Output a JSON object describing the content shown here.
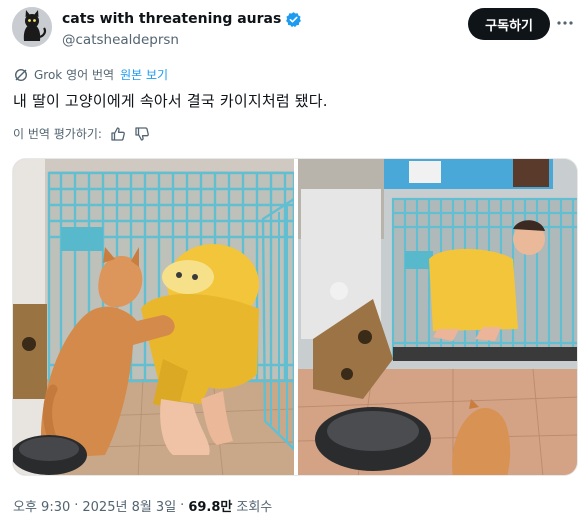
{
  "author": {
    "display_name": "cats with threatening auras",
    "handle": "@catshealdeprsn"
  },
  "follow_label": "구독하기",
  "grok": {
    "label": "Grok 영어 번역",
    "show_original": "원본 보기"
  },
  "tweet_text": "내 딸이 고양이에게 속아서 결국 카이지처럼 됐다.",
  "rate": {
    "label": "이 번역 평가하기:"
  },
  "meta": {
    "time": "오후 9:30",
    "separator1": "·",
    "date": "2025년 8월 3일",
    "separator2": "·",
    "views_count": "69.8만",
    "views_label": "조회수"
  },
  "colors": {
    "accent": "#1d9bf0",
    "cage": "#6ac3d4",
    "shirt": "#f2c53a"
  }
}
